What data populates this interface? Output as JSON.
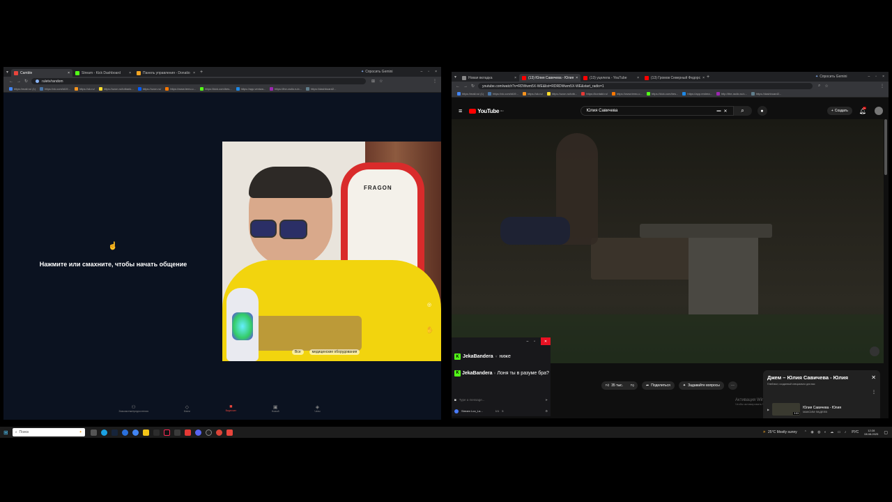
{
  "left_browser": {
    "tabs": [
      {
        "label": "Camble",
        "color": "#e8453c"
      },
      {
        "label": "Stream - Kick Dashboard",
        "color": "#53fc18"
      },
      {
        "label": "Панель управления - Donatio",
        "color": "#f5a623"
      }
    ],
    "gemini_label": "Спросить Gemini",
    "url": "ruletv/random",
    "bookmarks": [
      "https://mail.ru/ (1)",
      "https://vk.com/id19...",
      "https://ok.ru/",
      "https://ozon.ru/totbank...",
      "https://ozon.ru/",
      "https://www.temu.c...",
      "https://kick.com/bes...",
      "https://app.veniwa...",
      "https://the-radio.ru/c...",
      "https://dashboard2..."
    ],
    "prompt_text": "Нажмите или смахните, чтобы начать общение",
    "video_overlay": [
      "Все",
      "медицинские оборудования"
    ],
    "nav_items": [
      "Знакомства/предпочтения",
      "Книги",
      "Видеочат",
      "Новый",
      "Чаты"
    ],
    "camera_chair_brand": "FRAGON"
  },
  "right_browser": {
    "tabs": [
      {
        "label": "Новая вкладка",
        "color": "#888888"
      },
      {
        "label": "(13) Юлия Савичева - Юлия",
        "color": "#ff0000"
      },
      {
        "label": "(13) уцелела - YouTube",
        "color": "#ff0000"
      },
      {
        "label": "(13) Громов Северный Федорс",
        "color": "#ff0000"
      }
    ],
    "gemini_label": "Спросить Gemini",
    "url": "youtube.com/watch?v=RDWwm5X-WE&list=RDRDWwm5X-WE&start_radio=1",
    "bookmarks": [
      "https://mail.ru/ (1)",
      "https://vk.com/id19...",
      "https://ok.ru/",
      "https://ozon.ru/totb...",
      "https://kontakt.ru/",
      "https://www.temu.c...",
      "https://kick.com/bes...",
      "https://app.restrea...",
      "http://the-radio.ru/c...",
      "https://dashboard2..."
    ],
    "youtube": {
      "logo_text": "YouTube",
      "region": "RU",
      "search_value": "Юлия Савичева",
      "create_label": "Создать",
      "notif_count": "9+",
      "likes": "35 тыс.",
      "share": "Поделиться",
      "ask": "Задавайте вопросы",
      "playlist_title": "Джем – Юлия Савичева - Юлия",
      "playlist_sub": "Плейлист, созданный специально для вас",
      "playlist_item_title": "Юлия Савичева - Юлия",
      "playlist_item_channel": "МАКСИМ ФАДЕЕВ",
      "playlist_item_duration": "3:53",
      "watermark_1": "Активация Windows",
      "watermark_2": "Чтобы активировать Windows, перейдите в раздел..."
    }
  },
  "chat": {
    "messages": [
      {
        "user": "JekaBandera",
        "text": "ниже"
      },
      {
        "user": "JekaBandera",
        "text": "Лоня ты в разуме бра?"
      }
    ],
    "input_placeholder": "Type a message...",
    "stream_label": "Stream Loo_La...",
    "counter_a": "1/1",
    "counter_b": "5"
  },
  "taskbar": {
    "search_placeholder": "Поиск",
    "weather": "25°C  Mostly sunny",
    "lang": "РУС",
    "time": "12:28",
    "date": "08.08.2025"
  },
  "colors": {
    "kick_green": "#53fc18",
    "yt_red": "#ff0000",
    "dark_bg": "#0b1220"
  }
}
